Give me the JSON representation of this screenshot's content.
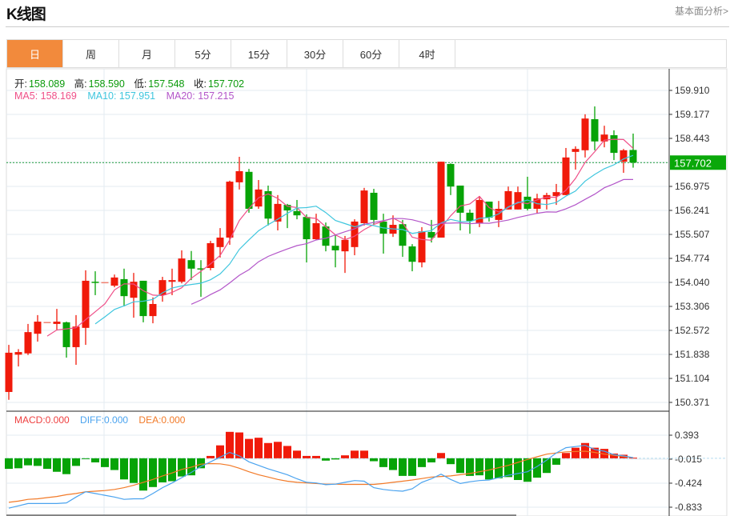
{
  "header": {
    "title": "K线图",
    "link": "基本面分析>"
  },
  "tabs": [
    {
      "label": "日",
      "active": true
    },
    {
      "label": "周"
    },
    {
      "label": "月"
    },
    {
      "label": "5分"
    },
    {
      "label": "15分"
    },
    {
      "label": "30分"
    },
    {
      "label": "60分"
    },
    {
      "label": "4时"
    }
  ],
  "ohlc": {
    "open_label": "开:",
    "open": "158.089",
    "high_label": "高:",
    "high": "158.590",
    "low_label": "低:",
    "low": "157.548",
    "close_label": "收:",
    "close": "157.702"
  },
  "ma": {
    "ma5": "MA5: 158.169",
    "ma10": "MA10: 157.951",
    "ma20": "MA20: 157.215"
  },
  "macd_info": {
    "macd": "MACD:0.000",
    "diff": "DIFF:0.000",
    "dea": "DEA:0.000"
  },
  "price_axis": [
    "159.910",
    "159.177",
    "158.443",
    "156.975",
    "156.241",
    "155.507",
    "154.774",
    "154.040",
    "153.306",
    "152.572",
    "151.838",
    "151.104",
    "150.371"
  ],
  "current_price": "157.702",
  "macd_axis": [
    "0.393",
    "-0.015",
    "-0.424",
    "-0.833"
  ],
  "colors": {
    "up": "#f01a0a",
    "down": "#07a307",
    "ma5": "#ef4f88",
    "ma10": "#3fc6de",
    "ma20": "#b356c9",
    "diff": "#4aa3ef",
    "dea": "#f27a28",
    "active_tab": "#f28a3c"
  },
  "chart_data": {
    "type": "candlestick",
    "ohlc_order": [
      "open",
      "high",
      "low",
      "close"
    ],
    "candles": [
      [
        150.69,
        152.13,
        150.45,
        151.89
      ],
      [
        151.83,
        152.0,
        151.47,
        151.91
      ],
      [
        151.87,
        152.77,
        151.82,
        152.52
      ],
      [
        152.47,
        153.04,
        152.23,
        152.84
      ],
      [
        152.83,
        152.83,
        152.83,
        152.83
      ],
      [
        152.77,
        153.23,
        152.57,
        152.84
      ],
      [
        152.82,
        152.84,
        151.74,
        152.06
      ],
      [
        152.06,
        153.04,
        151.52,
        152.69
      ],
      [
        152.65,
        154.41,
        152.13,
        154.09
      ],
      [
        154.06,
        154.38,
        153.65,
        154.03
      ],
      [
        154.05,
        154.05,
        154.05,
        154.05
      ],
      [
        153.94,
        154.28,
        153.89,
        154.19
      ],
      [
        154.14,
        154.46,
        153.31,
        153.62
      ],
      [
        153.57,
        154.33,
        152.96,
        154.06
      ],
      [
        154.09,
        154.09,
        152.82,
        153.01
      ],
      [
        153.01,
        153.58,
        152.79,
        153.38
      ],
      [
        153.65,
        154.21,
        153.45,
        154.11
      ],
      [
        154.06,
        154.46,
        153.65,
        154.11
      ],
      [
        154.06,
        155.02,
        154.01,
        154.77
      ],
      [
        154.72,
        155.0,
        154.11,
        154.46
      ],
      [
        154.47,
        154.72,
        153.6,
        154.45
      ],
      [
        154.48,
        155.31,
        154.41,
        155.24
      ],
      [
        155.12,
        155.7,
        154.8,
        155.41
      ],
      [
        155.41,
        157.15,
        155.19,
        157.12
      ],
      [
        157.1,
        157.88,
        156.88,
        157.44
      ],
      [
        157.42,
        157.51,
        156.17,
        156.29
      ],
      [
        156.36,
        157.17,
        156.29,
        156.88
      ],
      [
        156.83,
        157.0,
        155.78,
        155.99
      ],
      [
        155.9,
        156.71,
        155.63,
        156.44
      ],
      [
        156.41,
        156.44,
        155.7,
        156.24
      ],
      [
        156.22,
        156.56,
        155.97,
        156.09
      ],
      [
        156.04,
        156.12,
        154.65,
        155.36
      ],
      [
        155.36,
        156.14,
        155.34,
        155.85
      ],
      [
        155.75,
        155.87,
        154.99,
        155.16
      ],
      [
        155.16,
        155.48,
        154.5,
        155.02
      ],
      [
        154.99,
        155.46,
        154.33,
        155.34
      ],
      [
        155.12,
        155.97,
        154.87,
        155.9
      ],
      [
        155.85,
        156.93,
        155.78,
        156.85
      ],
      [
        156.78,
        156.9,
        155.8,
        155.95
      ],
      [
        155.9,
        156.14,
        154.92,
        155.53
      ],
      [
        155.53,
        156.09,
        155.43,
        155.8
      ],
      [
        155.82,
        155.95,
        154.82,
        155.16
      ],
      [
        155.14,
        155.21,
        154.38,
        154.67
      ],
      [
        154.65,
        155.73,
        154.5,
        155.6
      ],
      [
        155.58,
        155.95,
        155.26,
        155.41
      ],
      [
        155.41,
        157.73,
        155.41,
        157.73
      ],
      [
        157.66,
        157.68,
        156.71,
        156.97
      ],
      [
        157.0,
        157.0,
        155.63,
        156.17
      ],
      [
        156.17,
        156.27,
        155.53,
        155.92
      ],
      [
        155.85,
        156.68,
        155.73,
        156.56
      ],
      [
        156.51,
        156.51,
        155.9,
        156.02
      ],
      [
        155.95,
        156.53,
        155.73,
        156.29
      ],
      [
        156.27,
        156.97,
        156.27,
        156.83
      ],
      [
        156.27,
        156.97,
        156.27,
        156.8
      ],
      [
        156.66,
        157.27,
        156.24,
        156.29
      ],
      [
        156.29,
        156.75,
        156.14,
        156.61
      ],
      [
        156.58,
        156.78,
        156.27,
        156.71
      ],
      [
        156.68,
        157.05,
        156.41,
        156.8
      ],
      [
        156.71,
        158.15,
        156.71,
        157.86
      ],
      [
        158.03,
        158.2,
        157.49,
        158.12
      ],
      [
        158.08,
        159.18,
        157.86,
        159.05
      ],
      [
        159.03,
        159.42,
        158.08,
        158.35
      ],
      [
        158.35,
        158.83,
        158.17,
        158.56
      ],
      [
        158.54,
        158.69,
        157.78,
        158.0
      ],
      [
        157.73,
        158.12,
        157.39,
        158.08
      ],
      [
        158.089,
        158.59,
        157.548,
        157.702
      ]
    ],
    "ylim": [
      150.371,
      159.91
    ],
    "moving_averages": [
      "MA5",
      "MA10",
      "MA20"
    ],
    "macd": {
      "ylim": [
        -0.833,
        0.393
      ],
      "histogram": [
        -0.18,
        -0.17,
        -0.12,
        -0.13,
        -0.18,
        -0.23,
        -0.27,
        -0.13,
        -0.01,
        -0.07,
        -0.15,
        -0.2,
        -0.36,
        -0.42,
        -0.55,
        -0.49,
        -0.41,
        -0.39,
        -0.31,
        -0.29,
        -0.17,
        0.04,
        0.22,
        0.45,
        0.44,
        0.33,
        0.35,
        0.26,
        0.28,
        0.21,
        0.13,
        0.04,
        0.04,
        -0.04,
        -0.02,
        0.05,
        0.13,
        0.13,
        -0.05,
        -0.15,
        -0.2,
        -0.3,
        -0.3,
        -0.15,
        -0.07,
        0.09,
        -0.1,
        -0.25,
        -0.3,
        -0.29,
        -0.36,
        -0.34,
        -0.32,
        -0.37,
        -0.4,
        -0.33,
        -0.25,
        -0.11,
        0.09,
        0.18,
        0.26,
        0.18,
        0.16,
        0.08,
        0.06,
        0.01
      ],
      "diff": [
        -0.85,
        -0.81,
        -0.77,
        -0.77,
        -0.77,
        -0.77,
        -0.76,
        -0.66,
        -0.57,
        -0.6,
        -0.63,
        -0.66,
        -0.7,
        -0.69,
        -0.69,
        -0.6,
        -0.5,
        -0.42,
        -0.33,
        -0.24,
        -0.14,
        -0.06,
        0.02,
        0.1,
        0.04,
        -0.06,
        -0.12,
        -0.18,
        -0.23,
        -0.28,
        -0.35,
        -0.41,
        -0.42,
        -0.45,
        -0.44,
        -0.41,
        -0.38,
        -0.39,
        -0.5,
        -0.53,
        -0.55,
        -0.56,
        -0.52,
        -0.41,
        -0.35,
        -0.27,
        -0.36,
        -0.43,
        -0.4,
        -0.38,
        -0.37,
        -0.33,
        -0.29,
        -0.26,
        -0.23,
        -0.14,
        -0.03,
        0.09,
        0.18,
        0.2,
        0.22,
        0.15,
        0.12,
        0.06,
        0.04,
        0.01
      ],
      "dea": [
        -0.75,
        -0.73,
        -0.7,
        -0.69,
        -0.67,
        -0.65,
        -0.62,
        -0.6,
        -0.57,
        -0.56,
        -0.55,
        -0.53,
        -0.5,
        -0.46,
        -0.41,
        -0.36,
        -0.3,
        -0.25,
        -0.19,
        -0.15,
        -0.1,
        -0.09,
        -0.095,
        -0.12,
        -0.17,
        -0.23,
        -0.28,
        -0.32,
        -0.36,
        -0.39,
        -0.41,
        -0.42,
        -0.43,
        -0.44,
        -0.44,
        -0.445,
        -0.445,
        -0.445,
        -0.445,
        -0.43,
        -0.41,
        -0.39,
        -0.37,
        -0.345,
        -0.32,
        -0.31,
        -0.3,
        -0.28,
        -0.26,
        -0.23,
        -0.2,
        -0.16,
        -0.12,
        -0.07,
        -0.02,
        0.025,
        0.07,
        0.09,
        0.11,
        0.115,
        0.12,
        0.1,
        0.07,
        0.05,
        0.03,
        0.01
      ]
    }
  }
}
